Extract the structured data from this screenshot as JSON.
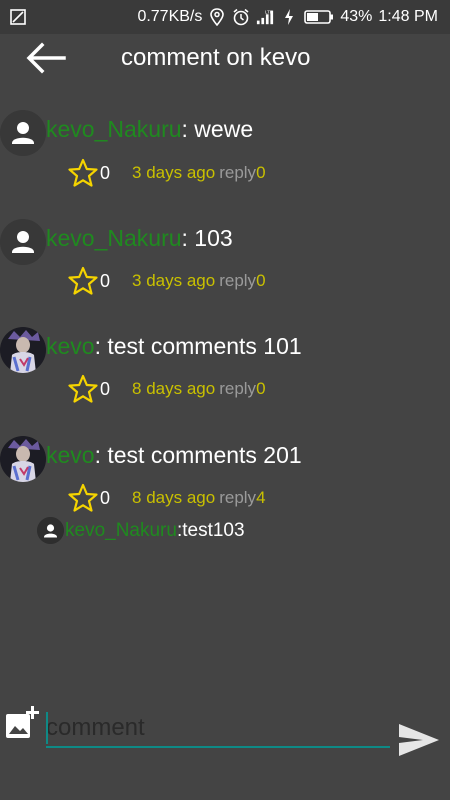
{
  "status_bar": {
    "speed": "0.77KB/s",
    "network": "LTE",
    "battery": "43%",
    "time": "1:48 PM"
  },
  "app_bar": {
    "title": "comment on kevo"
  },
  "comments": [
    {
      "user": "kevo_Nakuru",
      "sep": ":",
      "text": " wewe",
      "likes": "0",
      "time": "3 days ago",
      "reply_label": "reply",
      "reply_count": "0",
      "avatar": "default-user-icon"
    },
    {
      "user": "kevo_Nakuru",
      "sep": ":",
      "text": " 103",
      "likes": "0",
      "time": "3 days ago",
      "reply_label": "reply",
      "reply_count": "0",
      "avatar": "default-user-icon"
    },
    {
      "user": "kevo",
      "sep": ":",
      "text": " test comments 101",
      "likes": "0",
      "time": "8 days ago",
      "reply_label": "reply",
      "reply_count": "0",
      "avatar": "photo"
    },
    {
      "user": "kevo",
      "sep": ":",
      "text": " test comments 201",
      "likes": "0",
      "time": "8 days ago",
      "reply_label": "reply",
      "reply_count": "4",
      "avatar": "photo"
    }
  ],
  "reply": {
    "user": "kevo_Nakuru",
    "sep": ":",
    "text": " test103"
  },
  "composer": {
    "placeholder": "comment",
    "value": ""
  },
  "colors": {
    "background": "#444444",
    "username": "#1f8a1f",
    "time": "#c9c000",
    "star": "#f5d400",
    "input_underline": "#0e8a86"
  }
}
